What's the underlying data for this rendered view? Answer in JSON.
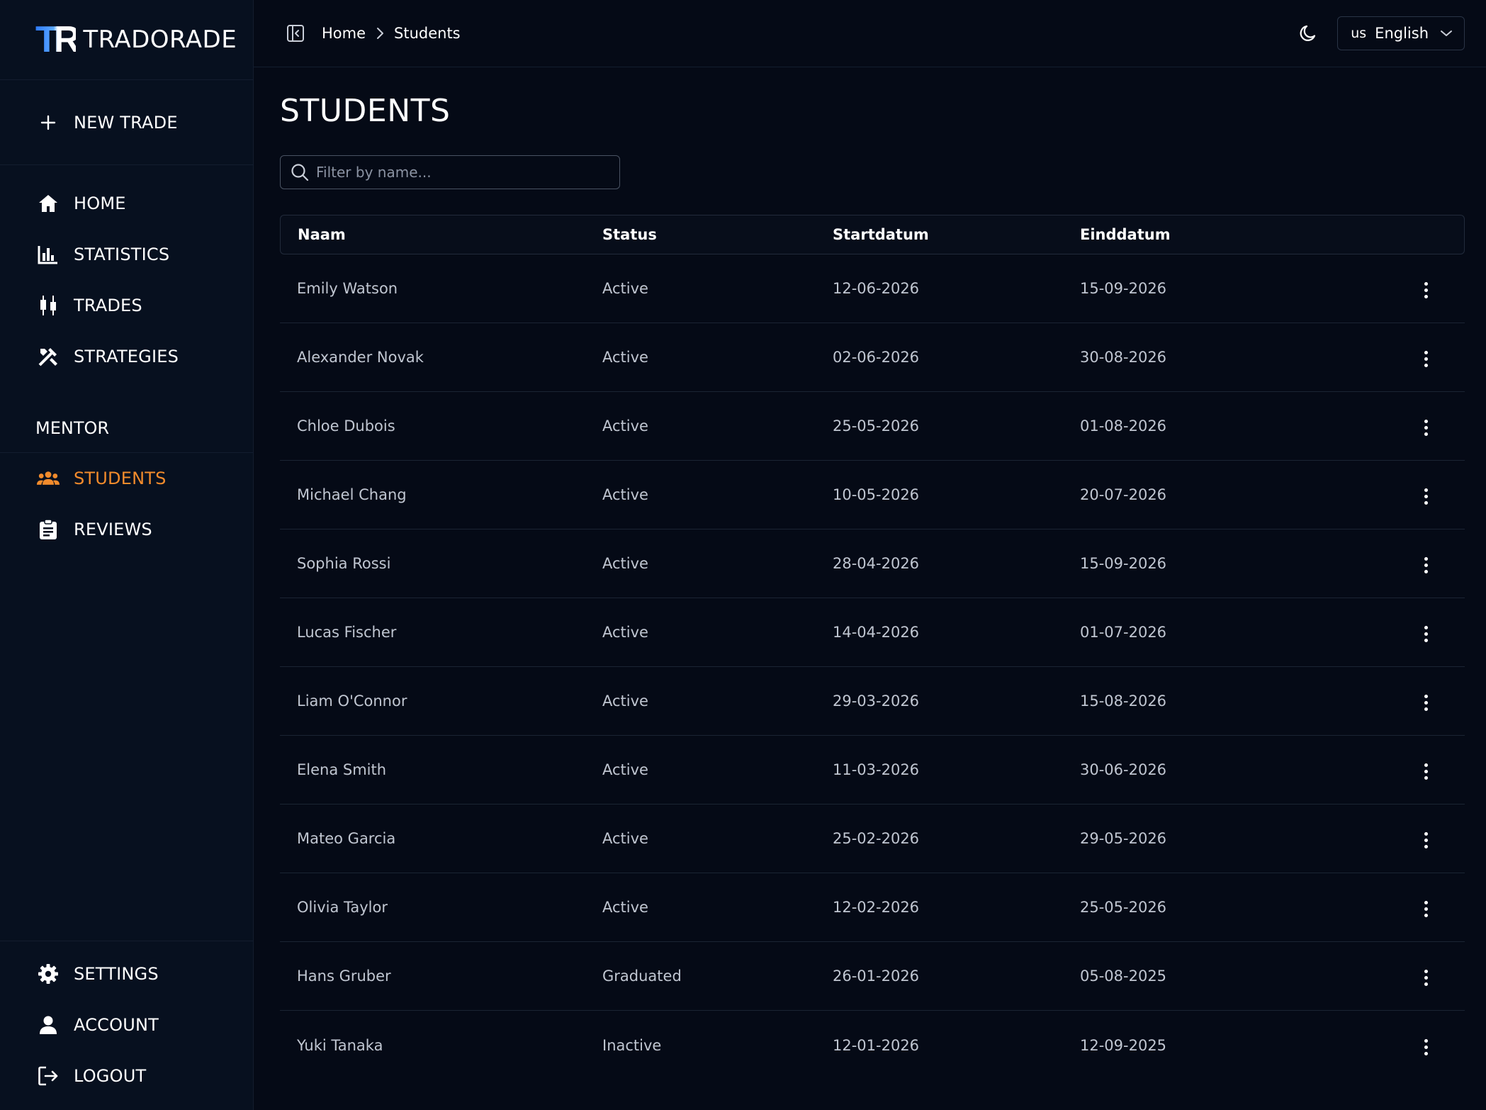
{
  "brand": {
    "mark": "TR",
    "name": "TRADORADE"
  },
  "sidebar": {
    "new_trade": "NEW TRADE",
    "main_items": [
      {
        "label": "HOME",
        "icon": "home-icon"
      },
      {
        "label": "STATISTICS",
        "icon": "bar-chart-icon"
      },
      {
        "label": "TRADES",
        "icon": "candlestick-icon"
      },
      {
        "label": "STRATEGIES",
        "icon": "tools-icon"
      }
    ],
    "mentor_title": "MENTOR",
    "mentor_items": [
      {
        "label": "STUDENTS",
        "icon": "users-icon",
        "active": true
      },
      {
        "label": "REVIEWS",
        "icon": "clipboard-icon"
      }
    ],
    "bottom_items": [
      {
        "label": "SETTINGS",
        "icon": "gear-icon"
      },
      {
        "label": "ACCOUNT",
        "icon": "user-icon"
      },
      {
        "label": "LOGOUT",
        "icon": "logout-icon"
      }
    ]
  },
  "topbar": {
    "breadcrumb": [
      "Home",
      "Students"
    ],
    "language_flag": "us",
    "language": "English"
  },
  "page": {
    "title": "STUDENTS",
    "filter_placeholder": "Filter by name..."
  },
  "table": {
    "headers": [
      "Naam",
      "Status",
      "Startdatum",
      "Einddatum"
    ],
    "rows": [
      [
        "Emily Watson",
        "Active",
        "12-06-2026",
        "15-09-2026"
      ],
      [
        "Alexander Novak",
        "Active",
        "02-06-2026",
        "30-08-2026"
      ],
      [
        "Chloe Dubois",
        "Active",
        "25-05-2026",
        "01-08-2026"
      ],
      [
        "Michael Chang",
        "Active",
        "10-05-2026",
        "20-07-2026"
      ],
      [
        "Sophia Rossi",
        "Active",
        "28-04-2026",
        "15-09-2026"
      ],
      [
        "Lucas Fischer",
        "Active",
        "14-04-2026",
        "01-07-2026"
      ],
      [
        "Liam O'Connor",
        "Active",
        "29-03-2026",
        "15-08-2026"
      ],
      [
        "Elena Smith",
        "Active",
        "11-03-2026",
        "30-06-2026"
      ],
      [
        "Mateo Garcia",
        "Active",
        "25-02-2026",
        "29-05-2026"
      ],
      [
        "Olivia Taylor",
        "Active",
        "12-02-2026",
        "25-05-2026"
      ],
      [
        "Hans Gruber",
        "Graduated",
        "26-01-2026",
        "05-08-2025"
      ],
      [
        "Yuki Tanaka",
        "Inactive",
        "12-01-2026",
        "12-09-2025"
      ]
    ]
  },
  "colors": {
    "background": "#050a16",
    "sidebar": "#07101f",
    "accent": "#f28b2c",
    "brand_blue": "#2e7bff"
  }
}
